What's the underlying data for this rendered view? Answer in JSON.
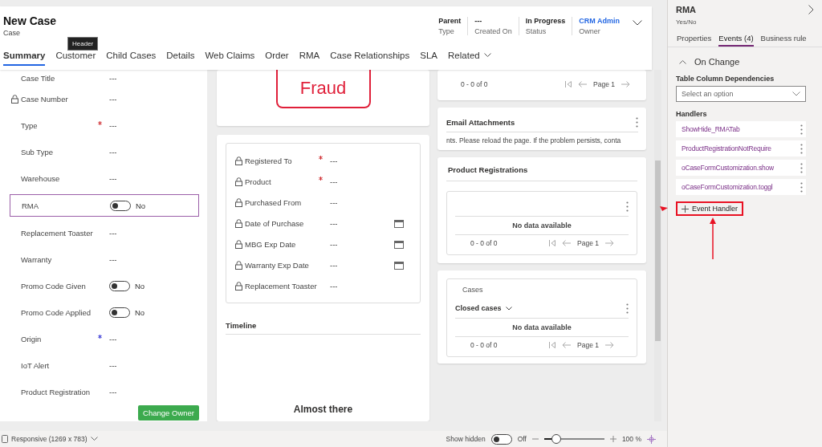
{
  "header": {
    "title": "New Case",
    "subtitle": "Case",
    "tooltip": "Header",
    "fields": [
      {
        "value": "Parent",
        "label": "Type",
        "kind": "text"
      },
      {
        "value": "---",
        "label": "Created On",
        "kind": "text"
      },
      {
        "value": "In Progress",
        "label": "Status",
        "kind": "text"
      },
      {
        "value": "CRM Admin",
        "label": "Owner",
        "kind": "link"
      }
    ]
  },
  "tabs": [
    {
      "label": "Summary",
      "selected": true,
      "kind": "tab"
    },
    {
      "label": "Customer",
      "selected": false,
      "kind": "tab"
    },
    {
      "label": "Child Cases",
      "selected": false,
      "kind": "tab"
    },
    {
      "label": "Details",
      "selected": false,
      "kind": "tab"
    },
    {
      "label": "Web Claims",
      "selected": false,
      "kind": "tab"
    },
    {
      "label": "Order",
      "selected": false,
      "kind": "tab"
    },
    {
      "label": "RMA",
      "selected": false,
      "kind": "tab"
    },
    {
      "label": "Case Relationships",
      "selected": false,
      "kind": "tab"
    },
    {
      "label": "SLA",
      "selected": false,
      "kind": "tab"
    },
    {
      "label": "Related",
      "selected": false,
      "kind": "menu"
    }
  ],
  "summary_fields": [
    {
      "label": "Case Title",
      "value": "---",
      "kind": "text",
      "locked": false,
      "required": false,
      "recommended": false,
      "selected": false
    },
    {
      "label": "Case Number",
      "value": "---",
      "kind": "text",
      "locked": true,
      "required": false,
      "recommended": false,
      "selected": false
    },
    {
      "label": "Type",
      "value": "---",
      "kind": "text",
      "locked": false,
      "required": true,
      "recommended": false,
      "selected": false
    },
    {
      "label": "Sub Type",
      "value": "---",
      "kind": "text",
      "locked": false,
      "required": false,
      "recommended": false,
      "selected": false
    },
    {
      "label": "Warehouse",
      "value": "---",
      "kind": "text",
      "locked": false,
      "required": false,
      "recommended": false,
      "selected": false
    },
    {
      "label": "RMA",
      "value": "No",
      "kind": "toggle",
      "on": false,
      "locked": false,
      "required": false,
      "recommended": false,
      "selected": true
    },
    {
      "label": "Replacement Toaster",
      "value": "---",
      "kind": "text",
      "locked": false,
      "required": false,
      "recommended": false,
      "selected": false
    },
    {
      "label": "Warranty",
      "value": "---",
      "kind": "text",
      "locked": false,
      "required": false,
      "recommended": false,
      "selected": false
    },
    {
      "label": "Promo Code Given",
      "value": "No",
      "kind": "toggle",
      "on": false,
      "locked": false,
      "required": false,
      "recommended": false,
      "selected": false
    },
    {
      "label": "Promo Code Applied",
      "value": "No",
      "kind": "toggle",
      "on": false,
      "locked": false,
      "required": false,
      "recommended": false,
      "selected": false
    },
    {
      "label": "Origin",
      "value": "---",
      "kind": "text",
      "locked": false,
      "required": false,
      "recommended": true,
      "selected": false
    },
    {
      "label": "IoT Alert",
      "value": "---",
      "kind": "text",
      "locked": false,
      "required": false,
      "recommended": false,
      "selected": false
    },
    {
      "label": "Product Registration",
      "value": "---",
      "kind": "text",
      "locked": false,
      "required": false,
      "recommended": false,
      "selected": false
    }
  ],
  "change_owner_button": "Change Owner",
  "fraud_label": "Fraud",
  "product_fields": [
    {
      "label": "Registered To",
      "value": "---",
      "locked": true,
      "required": true,
      "kind": "text"
    },
    {
      "label": "Product",
      "value": "---",
      "locked": true,
      "required": true,
      "kind": "text"
    },
    {
      "label": "Purchased From",
      "value": "---",
      "locked": true,
      "required": false,
      "kind": "text"
    },
    {
      "label": "Date of Purchase",
      "value": "---",
      "locked": true,
      "required": false,
      "kind": "date"
    },
    {
      "label": "MBG Exp Date",
      "value": "---",
      "locked": true,
      "required": false,
      "kind": "date"
    },
    {
      "label": "Warranty Exp Date",
      "value": "---",
      "locked": true,
      "required": false,
      "kind": "date"
    },
    {
      "label": "Replacement Toaster",
      "value": "---",
      "locked": true,
      "required": false,
      "kind": "text"
    }
  ],
  "timeline": {
    "title": "Timeline",
    "message": "Almost there"
  },
  "top_grid": {
    "count": "0 - 0 of 0",
    "page": "Page 1"
  },
  "email_attachments": {
    "title": "Email Attachments",
    "message": "nts.  Please reload the page. If the problem persists, conta"
  },
  "product_registrations": {
    "title": "Product Registrations",
    "empty": "No data available",
    "count": "0 - 0 of 0",
    "page": "Page 1"
  },
  "cases": {
    "title": "Cases",
    "view": "Closed cases",
    "empty": "No data available",
    "count": "0 - 0 of 0",
    "page": "Page 1"
  },
  "properties_panel": {
    "title": "RMA",
    "subtitle": "Yes/No",
    "tabs": [
      {
        "label": "Properties",
        "selected": false
      },
      {
        "label": "Events (4)",
        "selected": true
      },
      {
        "label": "Business rule",
        "selected": false
      }
    ],
    "section": {
      "title": "On Change",
      "expanded": true
    },
    "dependencies_label": "Table Column Dependencies",
    "dependencies_placeholder": "Select an option",
    "handlers_label": "Handlers",
    "handlers": [
      "ShowHide_RMATab",
      "ProductRegistrationNotRequire",
      "oCaseFormCustomization.show",
      "oCaseFormCustomization.toggl"
    ],
    "add_handler": "Event Handler"
  },
  "status_bar": {
    "viewport": "Responsive (1269 x 783)",
    "show_hidden": {
      "label": "Show hidden",
      "on": false,
      "value": "Off"
    },
    "zoom": {
      "level": 0.2,
      "reading": "100 %"
    }
  }
}
